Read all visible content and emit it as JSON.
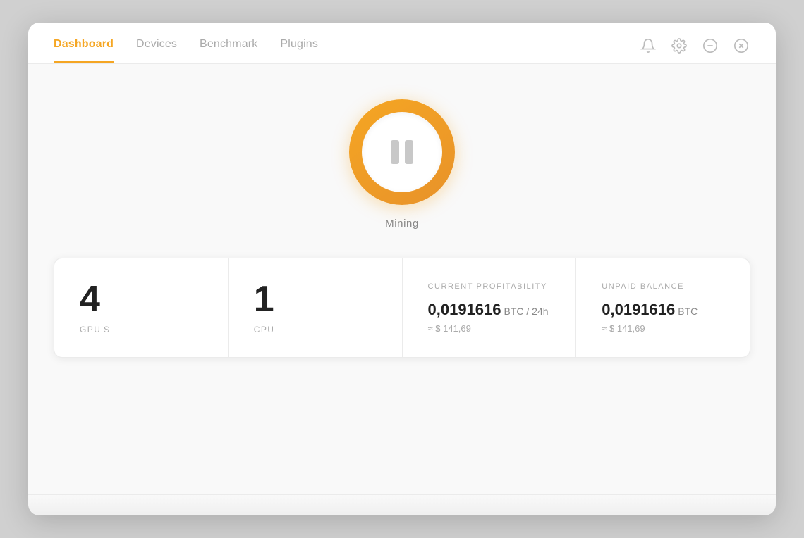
{
  "nav": {
    "items": [
      {
        "id": "dashboard",
        "label": "Dashboard",
        "active": true
      },
      {
        "id": "devices",
        "label": "Devices",
        "active": false
      },
      {
        "id": "benchmark",
        "label": "Benchmark",
        "active": false
      },
      {
        "id": "plugins",
        "label": "Plugins",
        "active": false
      }
    ]
  },
  "icons": {
    "bell": "bell-icon",
    "settings": "settings-icon",
    "minimize": "minimize-icon",
    "close": "close-icon"
  },
  "mining": {
    "button_label": "Mining",
    "state": "paused"
  },
  "stats": {
    "gpu": {
      "value": "4",
      "label": "GPU'S"
    },
    "cpu": {
      "value": "1",
      "label": "CPU"
    },
    "profitability": {
      "title": "CURRENT PROFITABILITY",
      "value": "0,0191616",
      "unit": "BTC / 24h",
      "usd": "≈ $ 141,69"
    },
    "balance": {
      "title": "UNPAID BALANCE",
      "value": "0,0191616",
      "unit": "BTC",
      "usd": "≈ $ 141,69"
    }
  }
}
